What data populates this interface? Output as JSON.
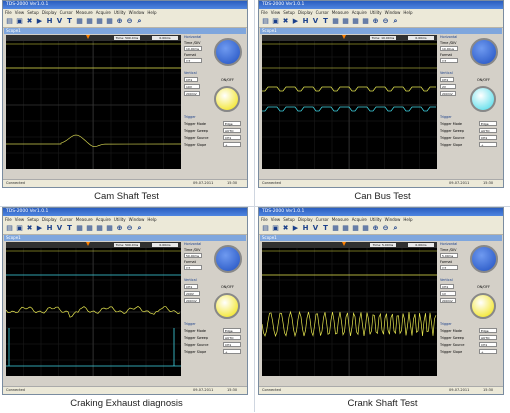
{
  "panels": [
    {
      "caption": "Cam Shaft Test",
      "window_title": "TDS-2000 Ver1.0.1",
      "doc_title": "Scope1",
      "time_div": "Time: 500.0ms",
      "record_len": "0.00ms",
      "channel_volts": "2V",
      "timebase": "10.00ms",
      "format": "Y-T",
      "vertical": "CH1",
      "volts_div": "10V",
      "probe": "200mV",
      "onoff": "ON/OFF",
      "trigger_mode": "Edge",
      "trigger_sweep": "AUTO",
      "trigger_source": "CH1",
      "trigger_slope": "+",
      "status_left": "Connected",
      "status_date": "09-07-2011",
      "status_time": "15:30",
      "ch_color": "#e8e850",
      "knob1": "#2050c0",
      "knob2": "#f0e000"
    },
    {
      "caption": "Can Bus Test",
      "window_title": "TDS-2000 Ver1.0.1",
      "doc_title": "Scope1",
      "time_div": "Time: 10.00ms",
      "record_len": "0.00ms",
      "channel_volts": "2V",
      "timebase": "10.00us",
      "format": "Y-T",
      "vertical": "CH1",
      "volts_div": "2V",
      "probe": "200mV",
      "onoff": "ON/OFF",
      "trigger_mode": "Edge",
      "trigger_sweep": "AUTO",
      "trigger_source": "CH1",
      "trigger_slope": "+",
      "status_left": "Connected",
      "status_date": "09-07-2011",
      "status_time": "15:30",
      "ch_color": "#e8e850",
      "knob1": "#2050c0",
      "knob2": "#40d8e8"
    },
    {
      "caption": "Craking Exhaust diagnosis",
      "window_title": "TDS-2000 Ver1.0.1",
      "doc_title": "Scope1",
      "time_div": "Time: 500.0ms",
      "record_len": "0.00ms",
      "channel_volts": "2V",
      "timebase": "50.00ms",
      "format": "Y-T",
      "vertical": "CH1",
      "volts_div": "200V",
      "probe": "200mV",
      "onoff": "ON/OFF",
      "trigger_mode": "Edge",
      "trigger_sweep": "AUTO",
      "trigger_source": "CH1",
      "trigger_slope": "+",
      "status_left": "Connected",
      "status_date": "09-07-2011",
      "status_time": "15:30",
      "ch_color": "#e8e850",
      "knob1": "#2050c0",
      "knob2": "#f0e000"
    },
    {
      "caption": "Crank Shaft Test",
      "window_title": "TDS-2000 Ver1.0.1",
      "doc_title": "Scope1",
      "time_div": "Time: 5.00ms",
      "record_len": "0.00ms",
      "channel_volts": "2V",
      "timebase": "5.00ms",
      "format": "Y-T",
      "vertical": "CH1",
      "volts_div": "1V",
      "probe": "200mV",
      "onoff": "ON/OFF",
      "trigger_mode": "Edge",
      "trigger_sweep": "AUTO",
      "trigger_source": "CH1",
      "trigger_slope": "+",
      "status_left": "Connected",
      "status_date": "09-07-2011",
      "status_time": "15:30",
      "ch_color": "#e8e850",
      "knob1": "#2050c0",
      "knob2": "#f0e000"
    }
  ],
  "labels": {
    "horizontal": "Horizontal",
    "time_div_label": "Time /DIV",
    "format_label": "Format",
    "vertical_label": "Vertical",
    "trigger_label": "Trigger",
    "trig_mode_label": "Trigger Mode",
    "trig_sweep_label": "Trigger Sweep",
    "trig_source_label": "Trigger Source",
    "trig_slope_label": "Trigger Slope",
    "auto": "AUTO"
  },
  "menu": [
    "File",
    "View",
    "Setup",
    "Display",
    "Cursor",
    "Measure",
    "Acquire",
    "Utility",
    "Window",
    "Help"
  ],
  "toolbar_icons": [
    "open-icon",
    "save-icon",
    "print-icon",
    "run-icon",
    "h-icon",
    "v-icon",
    "t-icon",
    "chart1-icon",
    "chart2-icon",
    "chart3-icon",
    "chart4-icon",
    "zoom-in-icon",
    "zoom-out-icon",
    "search-icon"
  ],
  "toolbar_glyphs": [
    "▤",
    "▣",
    "✖",
    "▶",
    "H",
    "V",
    "T",
    "▦",
    "▦",
    "▦",
    "▦",
    "⊕",
    "⊖",
    "⌕"
  ]
}
